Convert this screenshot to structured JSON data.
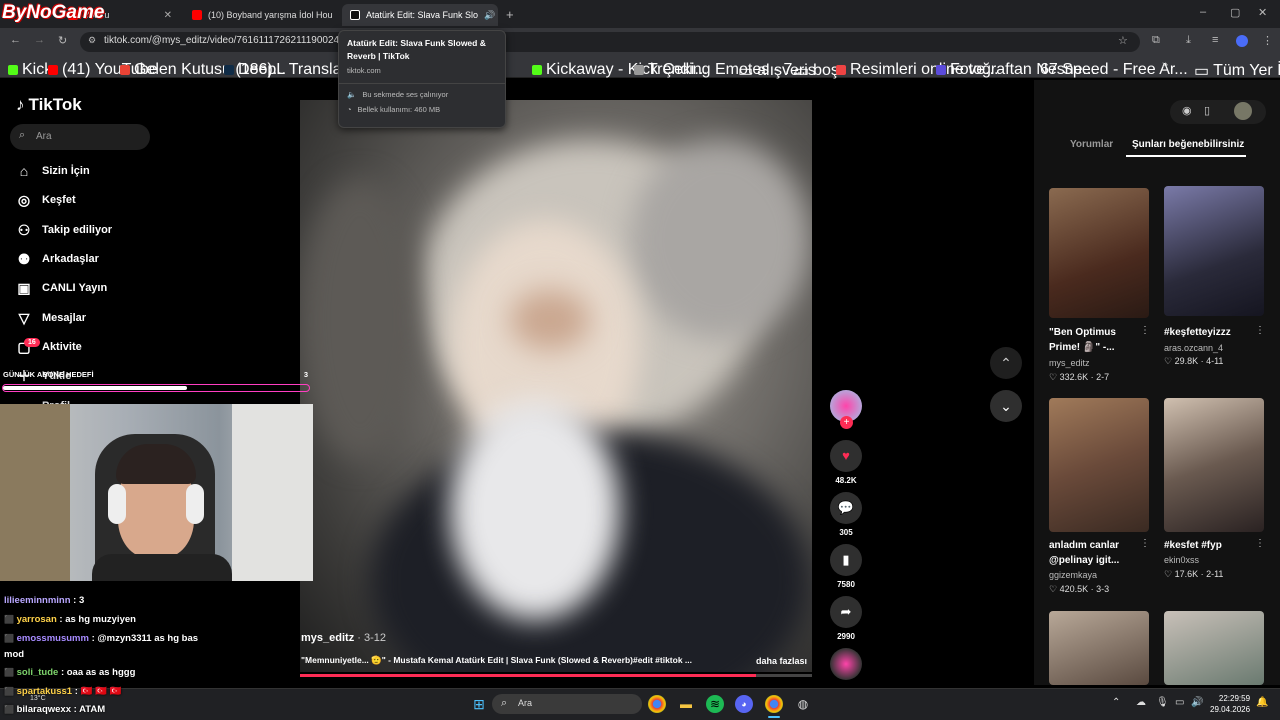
{
  "watermark": "ByNoGame",
  "browser": {
    "tabs": [
      {
        "label": "YouTu"
      },
      {
        "label": "(10) Boyband yarışma İdol Hou"
      },
      {
        "label": "Atatürk Edit: Slava Funk Slo"
      }
    ],
    "url": "tiktok.com/@mys_editz/video/7616111726211190024?_r",
    "bookmarks": [
      "Kick",
      "(41) YouTube",
      "Gelen Kutusu (186)...",
      "DeepL Translate: Th...",
      "Kickaway - Kick Çeki...",
      "Trending Emotes - 7...",
      "alışveris",
      "boş",
      "Resimleri online ve...",
      "Fotoğraftan Nesne...",
      "67 Speed - Free Ar..."
    ],
    "all_bookmarks": "Tüm Yer İşaretleri",
    "tooltip": {
      "title": "Atatürk Edit: Slava Funk Slowed & Reverb | TikTok",
      "domain": "tiktok.com",
      "audio": "Bu sekmede ses çalınıyor",
      "memory": "Bellek kullanımı: 460 MB"
    }
  },
  "tiktok": {
    "logo": "TikTok",
    "search_placeholder": "Ara",
    "nav": [
      {
        "label": "Sizin İçin"
      },
      {
        "label": "Keşfet"
      },
      {
        "label": "Takip ediliyor"
      },
      {
        "label": "Arkadaşlar"
      },
      {
        "label": "CANLI Yayın"
      },
      {
        "label": "Mesajlar"
      },
      {
        "label": "Aktivite",
        "badge": "16"
      },
      {
        "label": "Yükle"
      },
      {
        "label": "Profil"
      }
    ],
    "video": {
      "author": "mys_editz",
      "date": " · 3-12",
      "caption": "\"Memnuniyetle... 🫡\" - Mustafa Kemal Atatürk Edit | Slava Funk (Slowed & Reverb)#edit #tiktok ...",
      "more": "daha fazlası",
      "progress": 0.89
    },
    "actions": {
      "likes": "48.2K",
      "comments": "305",
      "saves": "7580",
      "shares": "2990"
    },
    "right": {
      "tab_comments": "Yorumlar",
      "tab_suggested": "Şunları beğenebilirsiniz",
      "items": [
        {
          "title": "\"Ben Optimus Prime! 🗿\" -...",
          "user": "mys_editz",
          "stats": "♡ 332.6K · 2-7",
          "color": "#5a3a2a"
        },
        {
          "title": "#keşfetteyizzz",
          "user": "aras.ozcann_4",
          "stats": "♡ 29.8K · 4-11",
          "color": "#3a3a4a"
        },
        {
          "title": "anladım canlar @pelinay igit...",
          "user": "ggizemkaya",
          "stats": "♡ 420.5K · 3-3",
          "color": "#6a5040"
        },
        {
          "title": "#kesfet #fyp",
          "user": "ekin0xss",
          "stats": "♡ 17.6K · 2-11",
          "color": "#3a3a3a"
        }
      ]
    }
  },
  "stream": {
    "goal_label": "GÜNLÜK ABONE HEDEFİ",
    "goal_count": "3",
    "goal_progress": 0.6,
    "chat": [
      {
        "user": "lilieeminnminn",
        "msg": " : 3",
        "color": "#b9a7ff"
      },
      {
        "user": "yarrosan",
        "msg": " : as hg muzyiyen",
        "color": "#ffd24a"
      },
      {
        "user": "emossmusumm",
        "msg": " : @mzyn3311 as hg bas",
        "color": "#a78bff"
      },
      {
        "user": "mod",
        "msg": "",
        "color": "#ffffff"
      },
      {
        "user": "soli_tude",
        "msg": " : oaa as as hggg",
        "color": "#7dd36b"
      },
      {
        "user": "spartakuss1",
        "msg": " : 🇹🇷 🇹🇷 🇹🇷",
        "color": "#ffd24a"
      },
      {
        "user": "bilaraqwexx",
        "msg": " : ATAM",
        "color": "#ffffff"
      }
    ]
  },
  "taskbar": {
    "search": "Ara",
    "time": "22:29:59",
    "date": "29.04.2026",
    "temp": "13°C"
  }
}
